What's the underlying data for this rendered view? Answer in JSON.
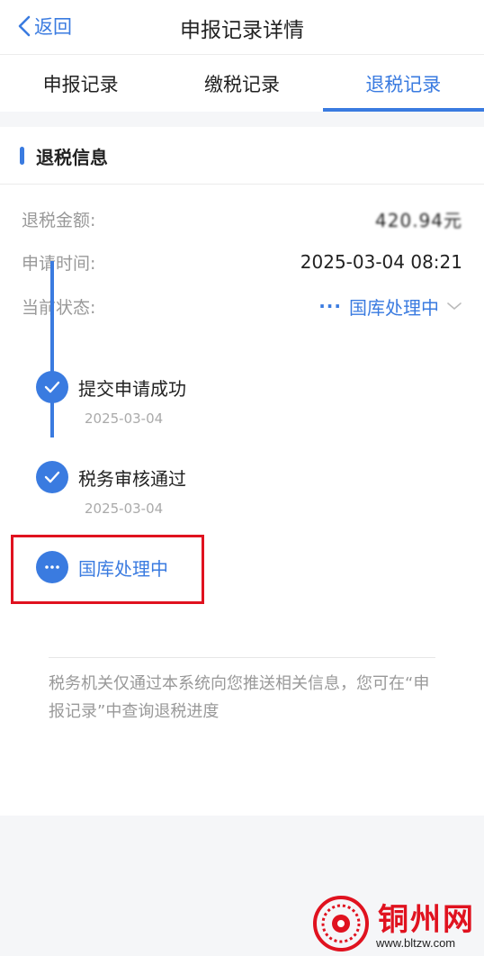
{
  "navbar": {
    "back_label": "返回",
    "title": "申报记录详情"
  },
  "tabs": [
    {
      "label": "申报记录",
      "active": false
    },
    {
      "label": "缴税记录",
      "active": false
    },
    {
      "label": "退税记录",
      "active": true
    }
  ],
  "section": {
    "title": "退税信息"
  },
  "info": {
    "amount_label": "退税金额:",
    "amount_value": "420.94元",
    "time_label": "申请时间:",
    "time_value": "2025-03-04 08:21",
    "status_label": "当前状态:",
    "status_value": "国库处理中",
    "status_dots": "···"
  },
  "timeline": [
    {
      "title": "提交申请成功",
      "date": "2025-03-04",
      "state": "done"
    },
    {
      "title": "税务审核通过",
      "date": "2025-03-04",
      "state": "done"
    },
    {
      "title": "国库处理中",
      "date": "",
      "state": "current"
    }
  ],
  "notice": "税务机关仅通过本系统向您推送相关信息，您可在“申报记录”中查询退税进度",
  "watermark": {
    "title": "铜州网",
    "url": "www.bltzw.com"
  },
  "colors": {
    "accent": "#3a7be0",
    "highlight": "#e0121f"
  }
}
